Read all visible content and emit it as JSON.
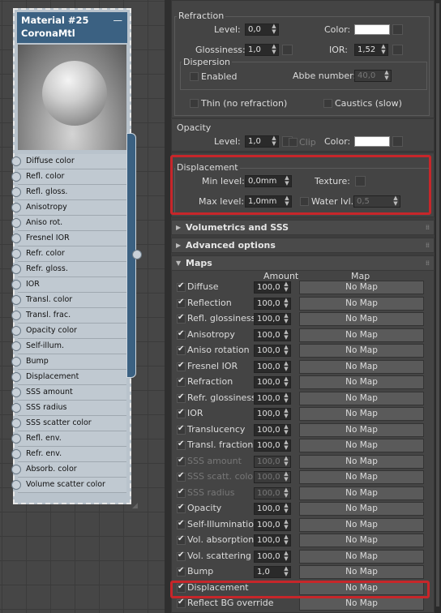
{
  "node": {
    "title": "Material #25",
    "subtitle": "CoronaMtl",
    "slots": [
      "Diffuse color",
      "Refl. color",
      "Refl. gloss.",
      "Anisotropy",
      "Aniso rot.",
      "Fresnel IOR",
      "Refr. color",
      "Refr. gloss.",
      "IOR",
      "Transl. color",
      "Transl. frac.",
      "Opacity color",
      "Self-illum.",
      "Bump",
      "Displacement",
      "SSS amount",
      "SSS radius",
      "SSS scatter color",
      "Refl. env.",
      "Refr. env.",
      "Absorb. color",
      "Volume scatter color"
    ]
  },
  "refraction": {
    "title": "Refraction",
    "level_label": "Level:",
    "level": "0,0",
    "color_label": "Color:",
    "color": "#ffffff",
    "gloss_label": "Glossiness:",
    "gloss": "1,0",
    "ior_label": "IOR:",
    "ior": "1,52",
    "dispersion_title": "Dispersion",
    "enabled_label": "Enabled",
    "abbe_label": "Abbe number:",
    "abbe": "40,0",
    "thin_label": "Thin (no refraction)",
    "caustics_label": "Caustics (slow)"
  },
  "opacity": {
    "title": "Opacity",
    "level_label": "Level:",
    "level": "1,0",
    "clip_label": "Clip",
    "color_label": "Color:",
    "color": "#ffffff"
  },
  "displacement": {
    "title": "Displacement",
    "min_label": "Min level:",
    "min": "0,0mm",
    "texture_label": "Texture:",
    "max_label": "Max level:",
    "max": "1,0mm",
    "water_label": "Water lvl.:",
    "water": "0,5"
  },
  "rollouts": {
    "volumetrics": "Volumetrics and SSS",
    "advanced": "Advanced options",
    "maps": "Maps"
  },
  "maps": {
    "amount_header": "Amount",
    "map_header": "Map",
    "rows": [
      {
        "label": "Diffuse",
        "amount": "100,0",
        "map": "No Map",
        "checked": true,
        "disabled": false
      },
      {
        "label": "Reflection",
        "amount": "100,0",
        "map": "No Map",
        "checked": true,
        "disabled": false
      },
      {
        "label": "Refl. glossiness",
        "amount": "100,0",
        "map": "No Map",
        "checked": true,
        "disabled": false
      },
      {
        "label": "Anisotropy",
        "amount": "100,0",
        "map": "No Map",
        "checked": true,
        "disabled": false
      },
      {
        "label": "Aniso rotation",
        "amount": "100,0",
        "map": "No Map",
        "checked": true,
        "disabled": false
      },
      {
        "label": "Fresnel IOR",
        "amount": "100,0",
        "map": "No Map",
        "checked": true,
        "disabled": false
      },
      {
        "label": "Refraction",
        "amount": "100,0",
        "map": "No Map",
        "checked": true,
        "disabled": false
      },
      {
        "label": "Refr. glossiness",
        "amount": "100,0",
        "map": "No Map",
        "checked": true,
        "disabled": false
      },
      {
        "label": "IOR",
        "amount": "100,0",
        "map": "No Map",
        "checked": true,
        "disabled": false
      },
      {
        "label": "Translucency",
        "amount": "100,0",
        "map": "No Map",
        "checked": true,
        "disabled": false
      },
      {
        "label": "Transl. fraction",
        "amount": "100,0",
        "map": "No Map",
        "checked": true,
        "disabled": false
      },
      {
        "label": "SSS amount",
        "amount": "100,0",
        "map": "No Map",
        "checked": true,
        "disabled": true
      },
      {
        "label": "SSS scatt. color",
        "amount": "100,0",
        "map": "No Map",
        "checked": true,
        "disabled": true
      },
      {
        "label": "SSS radius",
        "amount": "100,0",
        "map": "No Map",
        "checked": true,
        "disabled": true
      },
      {
        "label": "Opacity",
        "amount": "100,0",
        "map": "No Map",
        "checked": true,
        "disabled": false
      },
      {
        "label": "Self-Illumination",
        "amount": "100,0",
        "map": "No Map",
        "checked": true,
        "disabled": false
      },
      {
        "label": "Vol. absorption",
        "amount": "100,0",
        "map": "No Map",
        "checked": true,
        "disabled": false
      },
      {
        "label": "Vol. scattering",
        "amount": "100,0",
        "map": "No Map",
        "checked": true,
        "disabled": false
      },
      {
        "label": "Bump",
        "amount": "1,0",
        "map": "No Map",
        "checked": true,
        "disabled": false
      },
      {
        "label": "Displacement",
        "amount": "",
        "map": "No Map",
        "checked": true,
        "disabled": false
      },
      {
        "label": "Reflect BG override",
        "amount": "",
        "map": "No Map",
        "checked": true,
        "disabled": false
      }
    ]
  },
  "colors": {
    "highlight": "#c7262a",
    "node_header": "#3b6182"
  }
}
